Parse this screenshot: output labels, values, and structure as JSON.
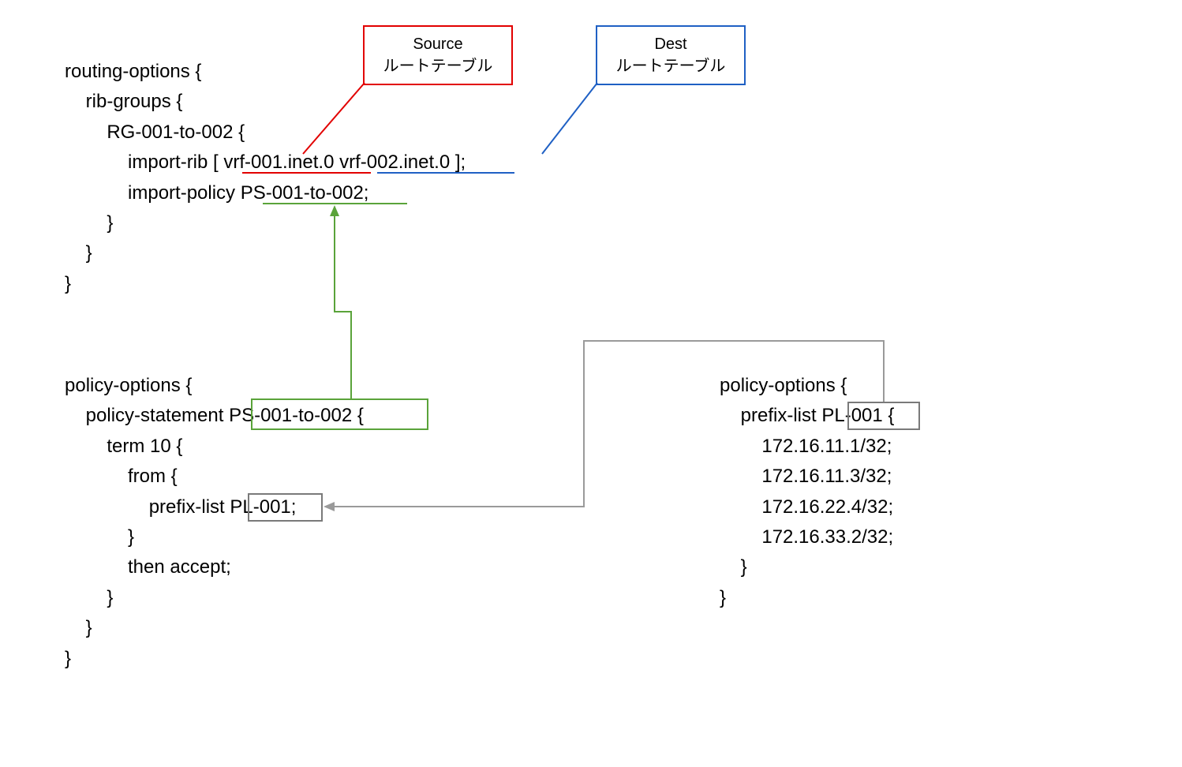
{
  "labels": {
    "source_title": "Source",
    "source_sub": "ルートテーブル",
    "dest_title": "Dest",
    "dest_sub": "ルートテーブル"
  },
  "routing_options_block": "routing-options {\n    rib-groups {\n        RG-001-to-002 {\n            import-rib [ vrf-001.inet.0 vrf-002.inet.0 ];\n            import-policy PS-001-to-002;\n        }\n    }\n}",
  "policy_statement_block": "policy-options {\n    policy-statement PS-001-to-002 {\n        term 10 {\n            from {\n                prefix-list PL-001;\n            }\n            then accept;\n        }\n    }\n}",
  "prefix_list_block": "policy-options {\n    prefix-list PL-001 {\n        172.16.11.1/32;\n        172.16.11.3/32;\n        172.16.22.4/32;\n        172.16.33.2/32;\n    }\n}",
  "highlighted": {
    "policy_statement_name": "PS-001-to-002",
    "prefix_list_ref": "PL-001",
    "prefix_list_def": "PL-001",
    "source_rib": "vrf-001.inet.0",
    "dest_rib": "vrf-002.inet.0",
    "import_policy": "PS-001-to-002"
  },
  "colors": {
    "red": "#e20000",
    "blue": "#1f60c4",
    "green": "#5aa33a",
    "gray": "#7a7a7a"
  }
}
